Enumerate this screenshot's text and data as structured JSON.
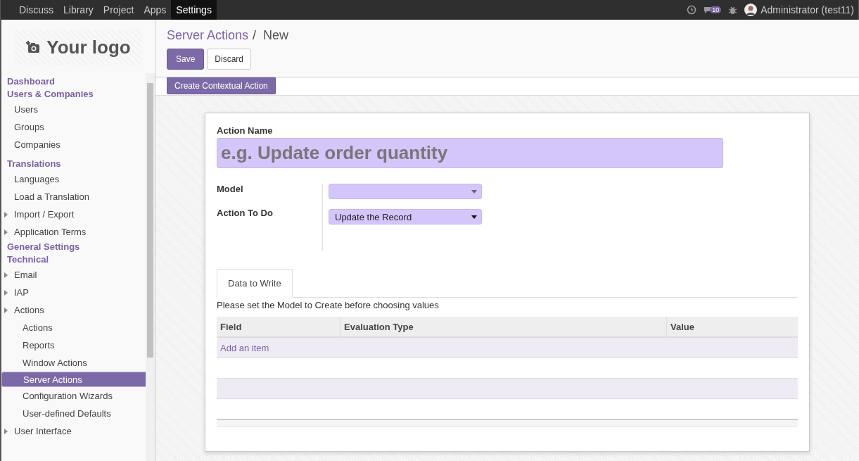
{
  "top_menu": [
    {
      "label": "Discuss",
      "selected": false
    },
    {
      "label": "Library",
      "selected": false
    },
    {
      "label": "Project",
      "selected": false
    },
    {
      "label": "Apps",
      "selected": false
    },
    {
      "label": "Settings",
      "selected": true
    }
  ],
  "systray": {
    "message_count": "10",
    "user": "Administrator (test11)"
  },
  "sidebar": {
    "logo": "Your logo",
    "sections": [
      {
        "label": "Dashboard"
      },
      {
        "label": "Users & Companies",
        "children": [
          {
            "label": "Users",
            "kind": "link",
            "selected": false
          },
          {
            "label": "Groups",
            "kind": "link",
            "selected": false
          },
          {
            "label": "Companies",
            "kind": "link",
            "selected": false
          }
        ]
      },
      {
        "label": "Translations",
        "children": [
          {
            "label": "Languages",
            "kind": "link",
            "selected": false
          },
          {
            "label": "Load a Translation",
            "kind": "link",
            "selected": false
          },
          {
            "label": "Import / Export",
            "kind": "folder",
            "selected": false
          },
          {
            "label": "Application Terms",
            "kind": "folder",
            "selected": false
          }
        ]
      },
      {
        "label": "General Settings"
      },
      {
        "label": "Technical",
        "children": [
          {
            "label": "Email",
            "kind": "folder",
            "selected": false
          },
          {
            "label": "IAP",
            "kind": "folder",
            "selected": false
          },
          {
            "label": "Actions",
            "kind": "folder",
            "selected": false,
            "children": [
              {
                "label": "Actions",
                "selected": false
              },
              {
                "label": "Reports",
                "selected": false
              },
              {
                "label": "Window Actions",
                "selected": false
              },
              {
                "label": "Server Actions",
                "selected": true
              },
              {
                "label": "Configuration Wizards",
                "selected": false
              },
              {
                "label": "User-defined Defaults",
                "selected": false
              }
            ]
          },
          {
            "label": "User Interface",
            "kind": "folder",
            "selected": false
          }
        ]
      }
    ]
  },
  "breadcrumb": {
    "items": [
      "Server Actions",
      "New"
    ],
    "separator": "/"
  },
  "buttons": {
    "save": "Save",
    "discard": "Discard",
    "contextual": "Create Contextual Action"
  },
  "form": {
    "name_label": "Action Name",
    "name_placeholder": "e.g. Update order quantity",
    "fields": [
      {
        "label": "Model"
      },
      {
        "label": "Action To Do",
        "value": "Update the Record"
      }
    ],
    "tabs": [
      {
        "label": "Data to Write",
        "selected": true
      }
    ],
    "help": "Please set the Model to Create before choosing values",
    "table": {
      "columns": [
        "Field",
        "Evaluation Type",
        "Value"
      ],
      "add_item": "Add an item"
    }
  }
}
